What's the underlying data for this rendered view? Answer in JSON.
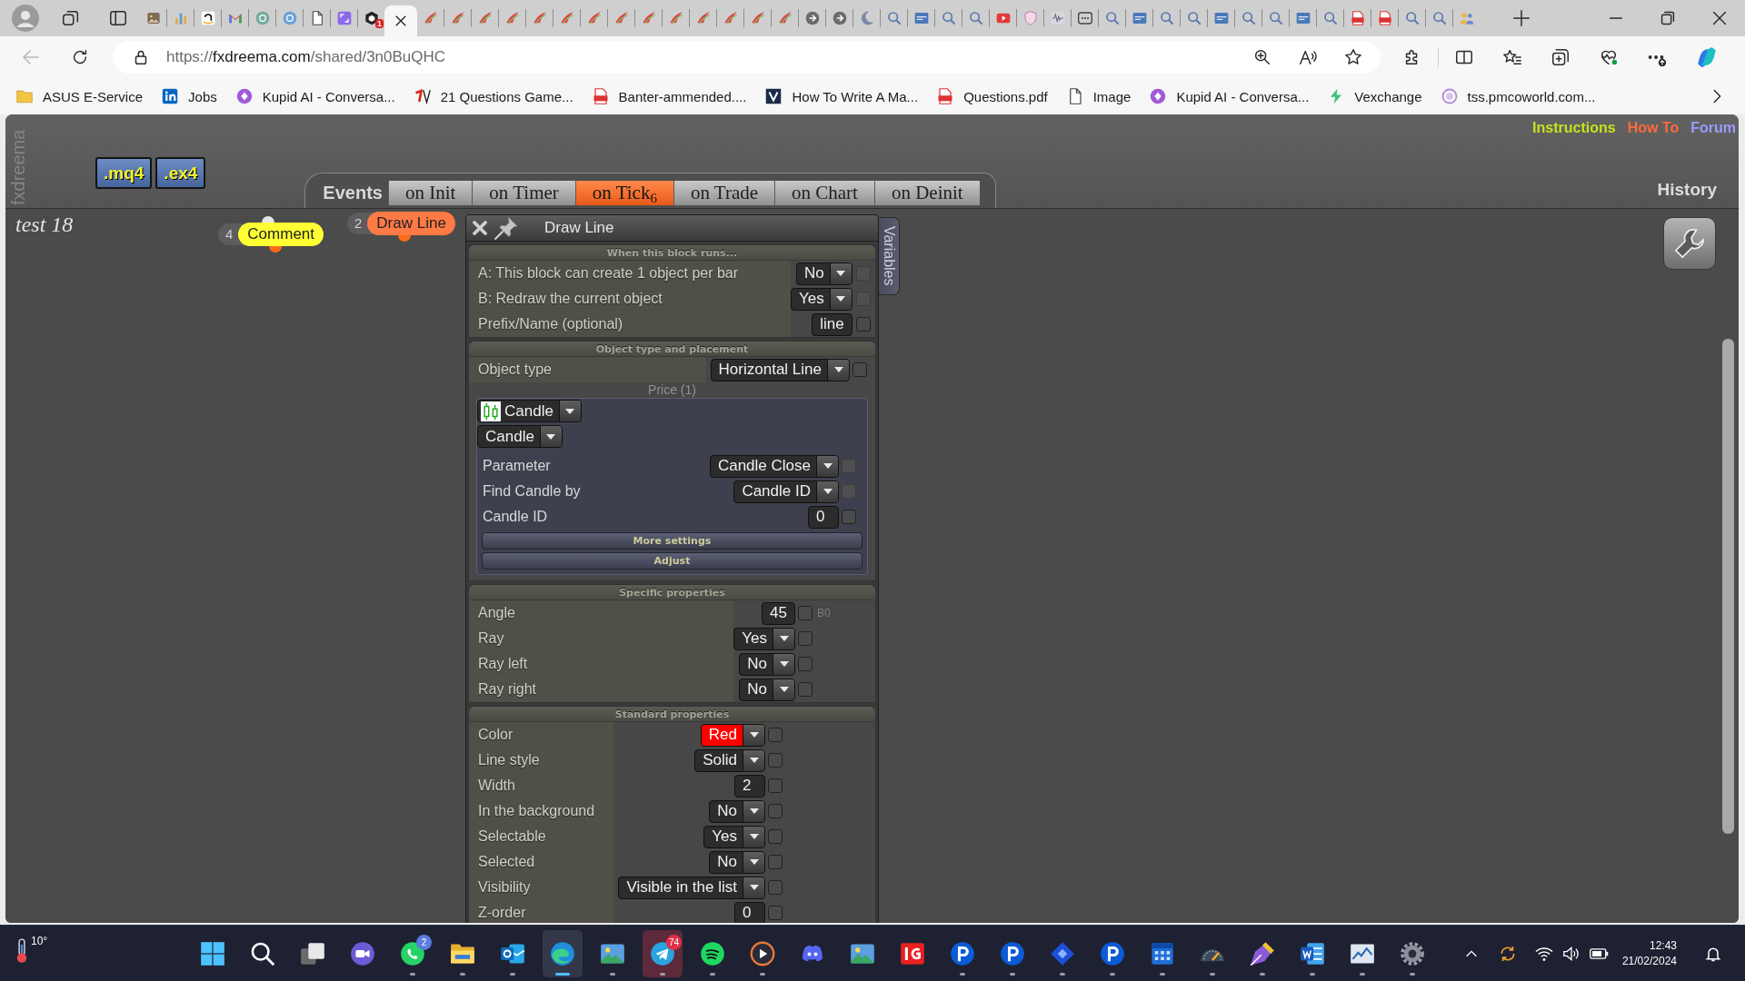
{
  "browser": {
    "tabs": [
      {
        "selected": false
      },
      {
        "selected": false
      },
      {
        "selected": false
      },
      {
        "selected": false
      },
      {
        "selected": false
      },
      {
        "selected": false
      },
      {
        "selected": false
      },
      {
        "selected": false
      },
      {
        "selected": false,
        "badge": "1"
      },
      {
        "selected": true
      },
      {
        "selected": false
      },
      {
        "selected": false
      },
      {
        "selected": false
      },
      {
        "selected": false
      },
      {
        "selected": false
      },
      {
        "selected": false
      },
      {
        "selected": false
      },
      {
        "selected": false
      },
      {
        "selected": false
      },
      {
        "selected": false
      },
      {
        "selected": false
      },
      {
        "selected": false
      },
      {
        "selected": false
      },
      {
        "selected": false
      },
      {
        "selected": false
      },
      {
        "selected": false
      },
      {
        "selected": false
      },
      {
        "selected": false
      },
      {
        "selected": false
      },
      {
        "selected": false
      },
      {
        "selected": false
      },
      {
        "selected": false
      },
      {
        "selected": false
      },
      {
        "selected": false
      },
      {
        "selected": false
      },
      {
        "selected": false
      },
      {
        "selected": false
      },
      {
        "selected": false
      },
      {
        "selected": false
      },
      {
        "selected": false
      },
      {
        "selected": false
      },
      {
        "selected": false
      },
      {
        "selected": false
      },
      {
        "selected": false
      },
      {
        "selected": false
      },
      {
        "selected": false
      },
      {
        "selected": false
      },
      {
        "selected": false
      },
      {
        "selected": false
      }
    ],
    "back": {
      "disabled": true
    },
    "address": {
      "scheme": "https://",
      "host": "fxdreema.com",
      "path": "/shared/3n0BuQHC"
    },
    "bookmarks": [
      "ASUS E-Service",
      "Jobs",
      "Kupid AI - Conversa...",
      "21 Questions Game...",
      "Banter-ammended....",
      "How To Write A Ma...",
      "Questions.pdf",
      "Image",
      "Kupid AI - Conversa...",
      "Vexchange",
      "tss.pmcoworld.com..."
    ]
  },
  "app": {
    "logo": "fxdreema",
    "exports": [
      ".mq4",
      ".ex4"
    ],
    "links": [
      {
        "label": "Instructions",
        "color": "#c8e01e"
      },
      {
        "label": "How To",
        "color": "#ff6a3c"
      },
      {
        "label": "Forum",
        "color": "#9c9cff"
      }
    ],
    "events_label": "Events",
    "event_tabs": [
      {
        "label": "on Init",
        "selected": false
      },
      {
        "label": "on Timer",
        "selected": false
      },
      {
        "label": "on Tick",
        "count": "6",
        "selected": true
      },
      {
        "label": "on Trade",
        "selected": false
      },
      {
        "label": "on Chart",
        "selected": false
      },
      {
        "label": "on Deinit",
        "selected": false
      }
    ],
    "history": "History",
    "project_name": "test 18",
    "blocks": [
      {
        "number": "4",
        "label": "Comment",
        "color": "#ffff33",
        "input_port": true
      },
      {
        "number": "2",
        "label": "Draw Line",
        "color": "#ff7a45",
        "input_port": false
      }
    ]
  },
  "dialog": {
    "title": "Draw Line",
    "side_tab": "Variables",
    "sections": [
      {
        "title": "When this block runs...",
        "rows": [
          {
            "kind": "dropdown",
            "label": "A: This block can create 1 object per bar",
            "value": "No",
            "checkbox": {
              "checked": false,
              "disabled": true
            }
          },
          {
            "kind": "dropdown",
            "label": "B: Redraw the current object",
            "value": "Yes",
            "checkbox": {
              "checked": false,
              "disabled": true
            }
          },
          {
            "kind": "input",
            "label": "Prefix/Name (optional)",
            "value": "line",
            "checkbox": {
              "checked": false,
              "disabled": false
            }
          }
        ]
      },
      {
        "title": "Object type and placement",
        "rows": [
          {
            "kind": "dropdown",
            "label": "Object type",
            "value": "Horizontal Line",
            "checkbox": {
              "checked": false,
              "disabled": false
            }
          },
          {
            "kind": "group",
            "caption": "Price (1)",
            "source": "Candle",
            "subtype": "Candle",
            "rows": [
              {
                "kind": "dropdown",
                "label": "Parameter",
                "value": "Candle Close",
                "checkbox": {
                  "checked": false,
                  "disabled": true
                }
              },
              {
                "kind": "dropdown",
                "label": "Find Candle by",
                "value": "Candle ID",
                "checkbox": {
                  "checked": false,
                  "disabled": true
                }
              },
              {
                "kind": "input",
                "label": "Candle ID",
                "value": "0",
                "checkbox": {
                  "checked": false,
                  "disabled": false
                }
              }
            ],
            "buttons": [
              "More settings",
              "Adjust"
            ]
          }
        ]
      },
      {
        "title": "Specific properties",
        "rows": [
          {
            "kind": "input",
            "label": "Angle",
            "value": "45",
            "checkbox": {
              "checked": false,
              "disabled": false
            },
            "suffix": "B0"
          },
          {
            "kind": "dropdown",
            "label": "Ray",
            "value": "Yes",
            "checkbox": {
              "checked": false,
              "disabled": false
            }
          },
          {
            "kind": "dropdown",
            "label": "Ray left",
            "value": "No",
            "checkbox": {
              "checked": false,
              "disabled": false
            }
          },
          {
            "kind": "dropdown",
            "label": "Ray right",
            "value": "No",
            "checkbox": {
              "checked": false,
              "disabled": false
            }
          }
        ]
      },
      {
        "title": "Standard properties",
        "rows": [
          {
            "kind": "dropdown",
            "label": "Color",
            "value": "Red",
            "color": "#ff0000",
            "checkbox": {
              "checked": false,
              "disabled": false
            }
          },
          {
            "kind": "dropdown",
            "label": "Line style",
            "value": "Solid",
            "checkbox": {
              "checked": false,
              "disabled": false
            }
          },
          {
            "kind": "input",
            "label": "Width",
            "value": "2",
            "checkbox": {
              "checked": false,
              "disabled": false
            }
          },
          {
            "kind": "dropdown",
            "label": "In the background",
            "value": "No",
            "checkbox": {
              "checked": false,
              "disabled": false
            }
          },
          {
            "kind": "dropdown",
            "label": "Selectable",
            "value": "Yes",
            "checkbox": {
              "checked": false,
              "disabled": false
            }
          },
          {
            "kind": "dropdown",
            "label": "Selected",
            "value": "No",
            "checkbox": {
              "checked": false,
              "disabled": false
            }
          },
          {
            "kind": "dropdown",
            "label": "Visibility",
            "value": "Visible in the list",
            "checkbox": {
              "checked": false,
              "disabled": false
            }
          },
          {
            "kind": "input",
            "label": "Z-order",
            "value": "0",
            "checkbox": {
              "checked": false,
              "disabled": false
            }
          }
        ]
      }
    ]
  },
  "taskbar": {
    "weather": "10°",
    "apps": [
      {
        "running": false,
        "selected": false,
        "attention": false
      },
      {
        "running": false,
        "selected": false,
        "attention": false
      },
      {
        "running": false,
        "selected": false,
        "attention": false
      },
      {
        "running": false,
        "selected": false,
        "attention": false
      },
      {
        "running": true,
        "selected": false,
        "attention": false,
        "badge": "2"
      },
      {
        "running": true,
        "selected": false,
        "attention": false
      },
      {
        "running": true,
        "selected": false,
        "attention": false
      },
      {
        "running": true,
        "selected": true,
        "attention": false
      },
      {
        "running": true,
        "selected": false,
        "attention": false
      },
      {
        "running": true,
        "selected": false,
        "attention": true,
        "badge": "74"
      },
      {
        "running": true,
        "selected": false,
        "attention": false
      },
      {
        "running": true,
        "selected": false,
        "attention": false
      },
      {
        "running": false,
        "selected": false,
        "attention": false
      },
      {
        "running": false,
        "selected": false,
        "attention": false
      },
      {
        "running": false,
        "selected": false,
        "attention": false
      },
      {
        "running": true,
        "selected": false,
        "attention": false
      },
      {
        "running": true,
        "selected": false,
        "attention": false
      },
      {
        "running": true,
        "selected": false,
        "attention": false
      },
      {
        "running": true,
        "selected": false,
        "attention": false
      },
      {
        "running": true,
        "selected": false,
        "attention": false
      },
      {
        "running": true,
        "selected": false,
        "attention": false
      },
      {
        "running": true,
        "selected": false,
        "attention": false
      },
      {
        "running": true,
        "selected": false,
        "attention": false
      },
      {
        "running": true,
        "selected": false,
        "attention": false
      },
      {
        "running": true,
        "selected": false,
        "attention": false
      }
    ],
    "time": "12:43",
    "date": "21/02/2024"
  }
}
